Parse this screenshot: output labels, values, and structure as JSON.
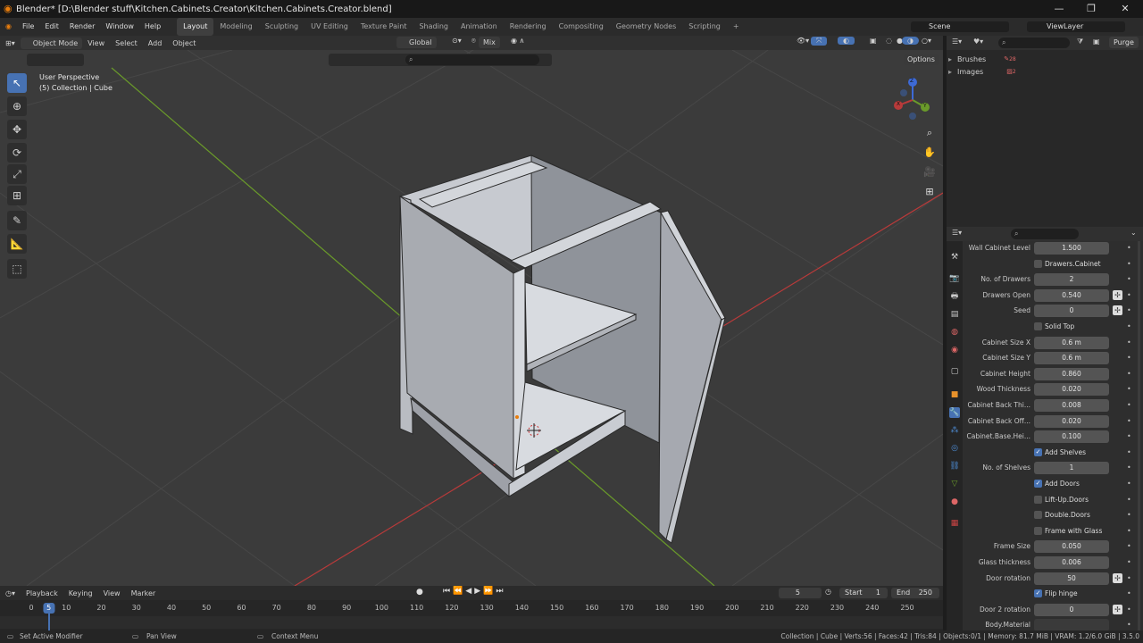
{
  "window": {
    "title": "Blender* [D:\\Blender stuff\\Kitchen.Cabinets.Creator\\Kitchen.Cabinets.Creator.blend]",
    "min": "—",
    "max": "❐",
    "close": "✕"
  },
  "menu": [
    "File",
    "Edit",
    "Render",
    "Window",
    "Help"
  ],
  "workspaces": [
    "Layout",
    "Modeling",
    "Sculpting",
    "UV Editing",
    "Texture Paint",
    "Shading",
    "Animation",
    "Rendering",
    "Compositing",
    "Geometry Nodes",
    "Scripting"
  ],
  "active_workspace": "Layout",
  "add_workspace": "+",
  "scene": "Scene",
  "view_layer": "ViewLayer",
  "viewport_header": {
    "mode": "Object Mode",
    "menus": [
      "View",
      "Select",
      "Add",
      "Object"
    ],
    "orientation": "Global",
    "snap": "Mix",
    "options": "Options"
  },
  "viewport_info": {
    "line1": "User Perspective",
    "line2": "(5) Collection | Cube"
  },
  "gizmo": {
    "x": "X",
    "y": "Y",
    "z": "Z"
  },
  "outliner": {
    "purge": "Purge",
    "items": [
      {
        "label": "Brushes",
        "count": "28"
      },
      {
        "label": "Images",
        "count": "2"
      }
    ]
  },
  "properties": {
    "rows": [
      {
        "type": "field",
        "label": "Wall Cabinet Level",
        "value": "1.500"
      },
      {
        "type": "check",
        "label": "Drawers.Cabinet",
        "checked": false
      },
      {
        "type": "field",
        "label": "No. of Drawers",
        "value": "2"
      },
      {
        "type": "field",
        "label": "Drawers Open",
        "value": "0.540",
        "anim": true
      },
      {
        "type": "field",
        "label": "Seed",
        "value": "0",
        "anim": true
      },
      {
        "type": "check",
        "label": "Solid Top",
        "checked": false
      },
      {
        "type": "field",
        "label": "Cabinet Size X",
        "value": "0.6 m"
      },
      {
        "type": "field",
        "label": "Cabinet Size Y",
        "value": "0.6 m"
      },
      {
        "type": "field",
        "label": "Cabinet Height",
        "value": "0.860"
      },
      {
        "type": "field",
        "label": "Wood Thickness",
        "value": "0.020"
      },
      {
        "type": "field",
        "label": "Cabinet Back Thi...",
        "value": "0.008"
      },
      {
        "type": "field",
        "label": "Cabinet Back Off...",
        "value": "0.020"
      },
      {
        "type": "field",
        "label": "Cabinet.Base.Hei...",
        "value": "0.100"
      },
      {
        "type": "check",
        "label": "Add Shelves",
        "checked": true
      },
      {
        "type": "field",
        "label": "No. of Shelves",
        "value": "1"
      },
      {
        "type": "check",
        "label": "Add Doors",
        "checked": true
      },
      {
        "type": "check",
        "label": "Lift-Up.Doors",
        "checked": false
      },
      {
        "type": "check",
        "label": "Double.Doors",
        "checked": false
      },
      {
        "type": "check",
        "label": "Frame with Glass",
        "checked": false
      },
      {
        "type": "field",
        "label": "Frame Size",
        "value": "0.050"
      },
      {
        "type": "field",
        "label": "Glass thickness",
        "value": "0.006"
      },
      {
        "type": "field",
        "label": "Door rotation",
        "value": "50",
        "anim": true
      },
      {
        "type": "check",
        "label": "Flip hinge",
        "checked": true
      },
      {
        "type": "field",
        "label": "Door 2 rotation",
        "value": "0",
        "anim": true
      },
      {
        "type": "material",
        "label": "Body.Material",
        "value": ""
      }
    ]
  },
  "timeline": {
    "menus": [
      "Playback",
      "Keying",
      "View",
      "Marker"
    ],
    "current_frame": "5",
    "start_label": "Start",
    "start": "1",
    "end_label": "End",
    "end": "250",
    "ticks": [
      "0",
      "10",
      "20",
      "30",
      "40",
      "50",
      "60",
      "70",
      "80",
      "90",
      "100",
      "110",
      "120",
      "130",
      "140",
      "150",
      "160",
      "170",
      "180",
      "190",
      "200",
      "210",
      "220",
      "230",
      "240",
      "250"
    ],
    "playhead": "5"
  },
  "status": {
    "left1": "Set Active Modifier",
    "left2": "Pan View",
    "left3": "Context Menu",
    "right": "Collection | Cube | Verts:56 | Faces:42 | Tris:84 | Objects:0/1 | Memory: 81.7 MiB | VRAM: 1.2/6.0 GiB | 3.5.0"
  },
  "colors": {
    "accent": "#4772b3",
    "viewport_bg": "#3b3b3b",
    "x_axis": "#b83a3a",
    "y_axis": "#6a9a2a"
  }
}
